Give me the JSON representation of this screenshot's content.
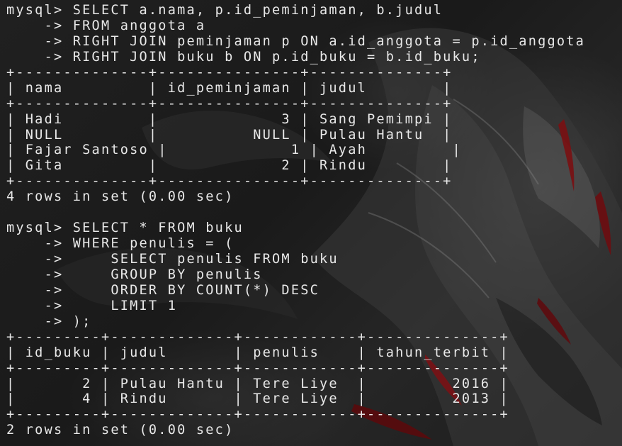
{
  "terminal": {
    "lines": [
      "mysql> SELECT a.nama, p.id_peminjaman, b.judul",
      "    -> FROM anggota a",
      "    -> RIGHT JOIN peminjaman p ON a.id_anggota = p.id_anggota",
      "    -> RIGHT JOIN buku b ON p.id_buku = b.id_buku;",
      "+--------------+---------------+--------------+",
      "| nama         | id_peminjaman | judul        |",
      "+--------------+---------------+--------------+",
      "| Hadi         |             3 | Sang Pemimpi |",
      "| NULL         |          NULL | Pulau Hantu  |",
      "| Fajar Santoso |             1 | Ayah         |",
      "| Gita         |             2 | Rindu        |",
      "+--------------+---------------+--------------+",
      "4 rows in set (0.00 sec)",
      "",
      "mysql> SELECT * FROM buku",
      "    -> WHERE penulis = (",
      "    ->     SELECT penulis FROM buku",
      "    ->     GROUP BY penulis",
      "    ->     ORDER BY COUNT(*) DESC",
      "    ->     LIMIT 1",
      "    -> );",
      "+---------+-------------+------------+--------------+",
      "| id_buku | judul       | penulis    | tahun_terbit |",
      "+---------+-------------+------------+--------------+",
      "|       2 | Pulau Hantu | Tere Liye  |         2016 |",
      "|       4 | Rindu       | Tere Liye  |         2013 |",
      "+---------+-------------+------------+--------------+",
      "2 rows in set (0.00 sec)"
    ]
  }
}
